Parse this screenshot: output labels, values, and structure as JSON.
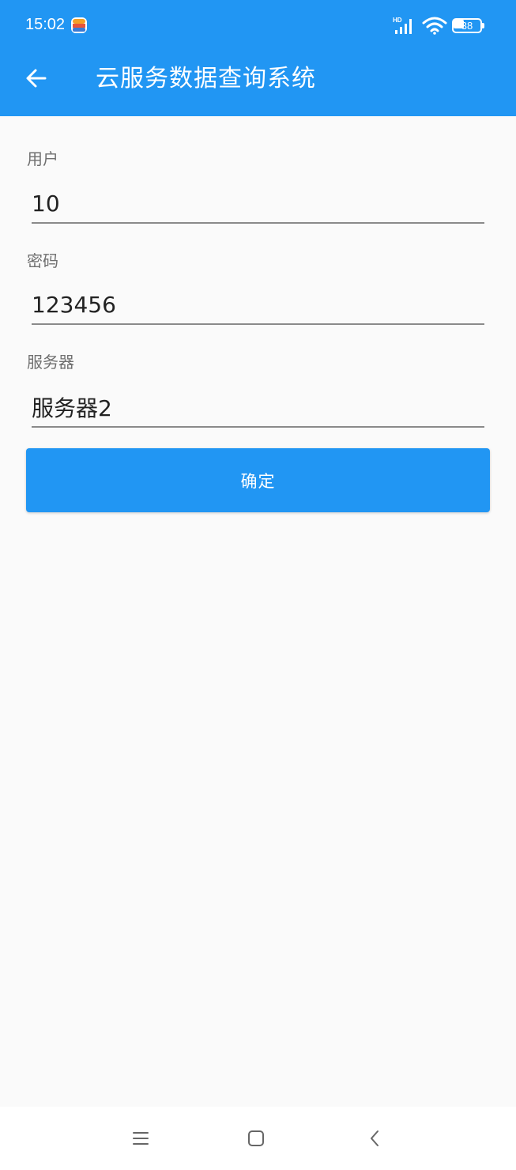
{
  "status_bar": {
    "time": "15:02",
    "network": "HD",
    "battery_level": "38"
  },
  "app_bar": {
    "title": "云服务数据查询系统"
  },
  "form": {
    "user_label": "用户",
    "user_value": "10",
    "password_label": "密码",
    "password_value": "123456",
    "server_label": "服务器",
    "server_value": "服务器2",
    "confirm_label": "确定"
  },
  "colors": {
    "primary": "#2196f3",
    "background": "#fafafa"
  }
}
